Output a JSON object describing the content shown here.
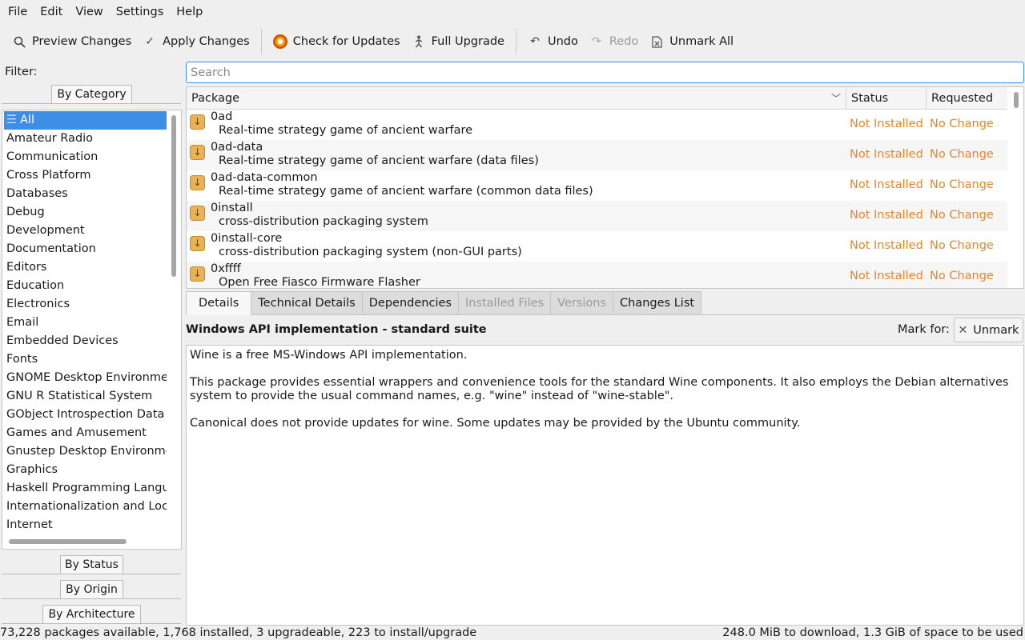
{
  "menu": [
    "File",
    "Edit",
    "View",
    "Settings",
    "Help"
  ],
  "toolbar": {
    "preview": "Preview Changes",
    "apply": "Apply Changes",
    "check": "Check for Updates",
    "upgrade": "Full Upgrade",
    "undo": "Undo",
    "redo": "Redo",
    "unmark_all": "Unmark All"
  },
  "filter": {
    "label": "Filter:",
    "by_category": "By Category",
    "by_status": "By Status",
    "by_origin": "By Origin",
    "by_architecture": "By Architecture",
    "categories": [
      "All",
      "Amateur Radio",
      "Communication",
      "Cross Platform",
      "Databases",
      "Debug",
      "Development",
      "Documentation",
      "Editors",
      "Education",
      "Electronics",
      "Email",
      "Embedded Devices",
      "Fonts",
      "GNOME Desktop Environment",
      "GNU R Statistical System",
      "GObject Introspection Data",
      "Games and Amusement",
      "Gnustep Desktop Environment",
      "Graphics",
      "Haskell Programming Language",
      "Internationalization and Localization",
      "Internet"
    ]
  },
  "search": {
    "placeholder": "Search"
  },
  "table": {
    "col_package": "Package",
    "col_status": "Status",
    "col_requested": "Requested",
    "rows": [
      {
        "name": "0ad",
        "desc": "Real-time strategy game of ancient warfare",
        "status": "Not Installed",
        "requested": "No Change"
      },
      {
        "name": "0ad-data",
        "desc": "Real-time strategy game of ancient warfare (data files)",
        "status": "Not Installed",
        "requested": "No Change"
      },
      {
        "name": "0ad-data-common",
        "desc": "Real-time strategy game of ancient warfare (common data files)",
        "status": "Not Installed",
        "requested": "No Change"
      },
      {
        "name": "0install",
        "desc": "cross-distribution packaging system",
        "status": "Not Installed",
        "requested": "No Change"
      },
      {
        "name": "0install-core",
        "desc": "cross-distribution packaging system (non-GUI parts)",
        "status": "Not Installed",
        "requested": "No Change"
      },
      {
        "name": "0xffff",
        "desc": "Open Free Fiasco Firmware Flasher",
        "status": "Not Installed",
        "requested": "No Change"
      }
    ]
  },
  "tabs": {
    "details": "Details",
    "technical": "Technical Details",
    "dependencies": "Dependencies",
    "installed_files": "Installed Files",
    "versions": "Versions",
    "changes_list": "Changes List"
  },
  "details": {
    "title": "Windows API implementation - standard suite",
    "mark_for": "Mark for:",
    "unmark": "Unmark",
    "paragraphs": [
      "Wine is a free MS-Windows API implementation.",
      "This package provides essential wrappers and convenience tools for the standard Wine components. It also employs the Debian alternatives system to provide the usual command names, e.g. \"wine\" instead of \"wine-stable\".",
      "Canonical does not provide updates for wine. Some updates may be provided by the Ubuntu community."
    ]
  },
  "status": {
    "left": "73,228 packages available, 1,768 installed, 3 upgradeable, 223 to install/upgrade",
    "right": "248.0 MiB to download, 1.3 GiB of space to be used"
  },
  "colors": {
    "accent": "#3d8ee7",
    "status_text": "#e5852a"
  }
}
